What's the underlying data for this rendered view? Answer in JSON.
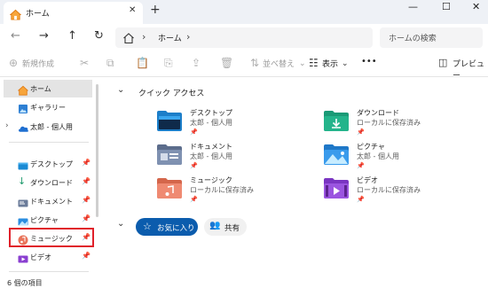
{
  "tab": {
    "title": "ホーム",
    "close": "✕",
    "new": "+"
  },
  "window": {
    "minimize": "—",
    "maximize": "☐",
    "close": "✕"
  },
  "nav": {
    "back": "←",
    "forward": "→",
    "up": "↑",
    "refresh": "↻"
  },
  "address": {
    "sep": "›",
    "crumb": "ホーム"
  },
  "search": {
    "placeholder": "ホームの検索"
  },
  "toolbar": {
    "new": "新規作成",
    "sort": "並べ替え",
    "view": "表示",
    "more": "•••",
    "preview": "プレビュー"
  },
  "sidebar": {
    "items": [
      {
        "label": "ホーム"
      },
      {
        "label": "ギャラリー"
      },
      {
        "label": "太郎 - 個人用"
      },
      {
        "label": "デスクトップ"
      },
      {
        "label": "ダウンロード"
      },
      {
        "label": "ドキュメント"
      },
      {
        "label": "ピクチャ"
      },
      {
        "label": "ミュージック"
      },
      {
        "label": "ビデオ"
      }
    ]
  },
  "quick_access": {
    "heading": "クイック アクセス",
    "tiles": [
      {
        "name": "デスクトップ",
        "sub": "太郎 - 個人用"
      },
      {
        "name": "ダウンロード",
        "sub": "ローカルに保存済み"
      },
      {
        "name": "ドキュメント",
        "sub": "太郎 - 個人用"
      },
      {
        "name": "ピクチャ",
        "sub": "太郎 - 個人用"
      },
      {
        "name": "ミュージック",
        "sub": "ローカルに保存済み"
      },
      {
        "name": "ビデオ",
        "sub": "ローカルに保存済み"
      }
    ]
  },
  "filters": {
    "favorites": "お気に入り",
    "shared": "共有"
  },
  "status": "6 個の項目",
  "colors": {
    "accent": "#0b5cad",
    "highlight": "#e0202a"
  }
}
